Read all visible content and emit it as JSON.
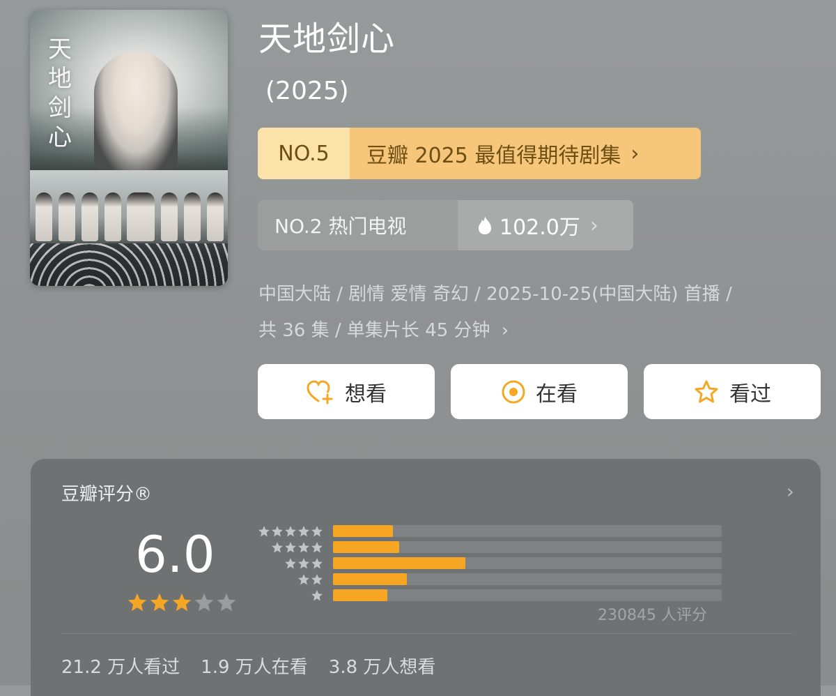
{
  "poster": {
    "title_art": "天地剑心"
  },
  "title": "天地剑心",
  "year": "(2025)",
  "rank_list": {
    "no": "NO.5",
    "label": "豆瓣 2025 最值得期待剧集",
    "chevron": "›"
  },
  "hot_rank": {
    "no": "NO.2 热门电视",
    "heat": "102.0万",
    "chevron": "›"
  },
  "meta": {
    "line1": "中国大陆 / 剧情 爱情 奇幻 / 2025-10-25(中国大陆) 首播 /",
    "line2": "共 36 集 / 单集片长 45 分钟",
    "chevron": "›"
  },
  "actions": [
    {
      "label": "想看",
      "icon": "heart-plus-icon"
    },
    {
      "label": "在看",
      "icon": "target-icon"
    },
    {
      "label": "看过",
      "icon": "star-outline-icon"
    }
  ],
  "rating": {
    "title": "豆瓣评分®",
    "score": "6.0",
    "stars_filled": 3,
    "stars_total": 5,
    "distribution": [
      {
        "stars": 5,
        "fraction": 0.155
      },
      {
        "stars": 4,
        "fraction": 0.17
      },
      {
        "stars": 3,
        "fraction": 0.34
      },
      {
        "stars": 2,
        "fraction": 0.19
      },
      {
        "stars": 1,
        "fraction": 0.14
      }
    ],
    "count": "230845 人评分",
    "stats": {
      "watched": "21.2 万人看过",
      "watching": "1.9 万人在看",
      "want": "3.8 万人想看"
    }
  },
  "colors": {
    "accent_orange": "#f6a623",
    "rank_yellow": "#f6c67a",
    "rank_yellow_light": "#fbe2a9",
    "text_brown": "#6e4e12"
  }
}
